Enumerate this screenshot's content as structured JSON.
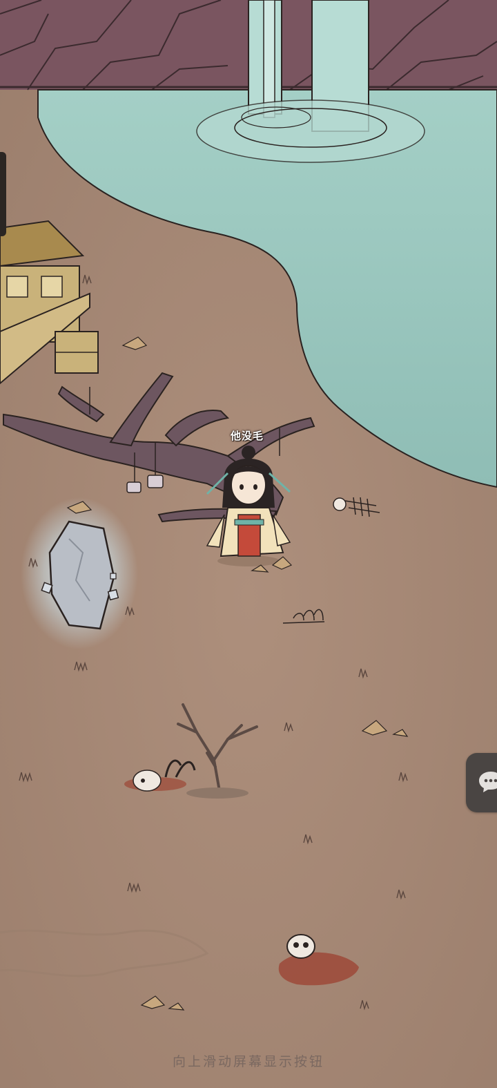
{
  "character": {
    "name": "他没毛"
  },
  "hint": {
    "text": "向上滑动屏幕显示按钮"
  },
  "icons": {
    "chat": "chat-bubble-icon",
    "side_tab": "side-panel-tab"
  },
  "colors": {
    "ground": "#a88a78",
    "water": "#9cc7bf",
    "cliff": "#7a5560",
    "hint_text": "#7a6860"
  }
}
